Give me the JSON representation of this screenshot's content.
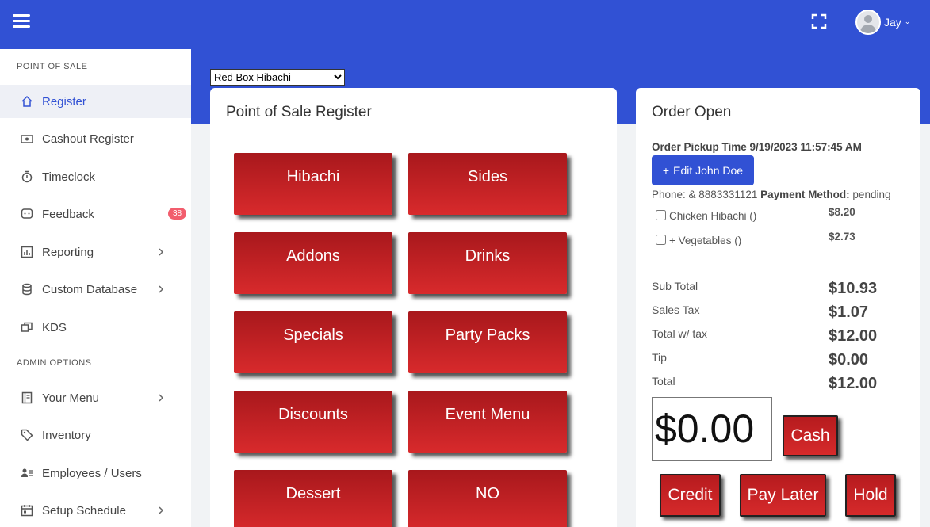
{
  "header": {
    "user_name": "Jay",
    "user_caret": "⌄"
  },
  "sidebar": {
    "section_pos": "POINT OF SALE",
    "section_admin": "ADMIN OPTIONS",
    "items": [
      {
        "label": "Register"
      },
      {
        "label": "Cashout Register"
      },
      {
        "label": "Timeclock"
      },
      {
        "label": "Feedback",
        "badge": "38"
      },
      {
        "label": "Reporting"
      },
      {
        "label": "Custom Database"
      },
      {
        "label": "KDS"
      },
      {
        "label": "Your Menu"
      },
      {
        "label": "Inventory"
      },
      {
        "label": "Employees / Users"
      },
      {
        "label": "Setup Schedule"
      }
    ]
  },
  "store_select": {
    "selected": "Red Box Hibachi"
  },
  "pos": {
    "title": "Point of Sale Register",
    "categories": [
      "Hibachi",
      "Sides",
      "Addons",
      "Drinks",
      "Specials",
      "Party Packs",
      "Discounts",
      "Event Menu",
      "Dessert",
      "NO"
    ]
  },
  "order": {
    "title": "Order Open",
    "pickup": "Order Pickup Time 9/19/2023 11:57:45 AM",
    "edit_button": "Edit John Doe",
    "phone_text": "Phone: & 8883331121",
    "payment_label": "Payment Method:",
    "payment_value": "pending",
    "items": [
      {
        "name": "Chicken Hibachi ()",
        "price": "$8.20"
      },
      {
        "name": "+ Vegetables ()",
        "price": "$2.73"
      }
    ],
    "summary": [
      {
        "label": "Sub Total",
        "value": "$10.93"
      },
      {
        "label": "Sales Tax",
        "value": "$1.07"
      },
      {
        "label": "Total w/ tax",
        "value": "$12.00"
      },
      {
        "label": "Tip",
        "value": "$0.00"
      },
      {
        "label": "Total",
        "value": "$12.00"
      }
    ],
    "tender_amount": "$0.00",
    "buttons": {
      "cash": "Cash",
      "credit": "Credit",
      "pay_later": "Pay Later",
      "hold": "Hold"
    }
  },
  "colors": {
    "primary": "#3151d4",
    "button_red": "#d62a2b",
    "badge": "#f25d6d"
  }
}
